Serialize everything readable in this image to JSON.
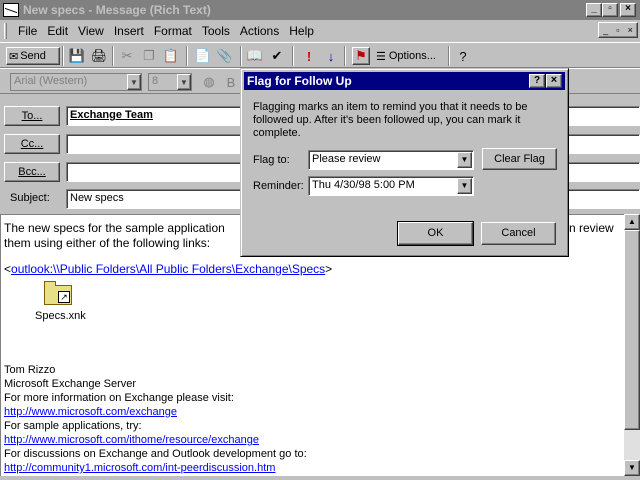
{
  "window": {
    "title": "New specs - Message (Rich Text)"
  },
  "menu": [
    "File",
    "Edit",
    "View",
    "Insert",
    "Format",
    "Tools",
    "Actions",
    "Help"
  ],
  "toolbar": {
    "send_label": "Send",
    "options_label": "Options..."
  },
  "format_toolbar": {
    "font": "Arial (Western)",
    "size": "8"
  },
  "addresses": {
    "to_button": "To...",
    "cc_button": "Cc...",
    "bcc_button": "Bcc...",
    "subject_label": "Subject:",
    "to_value": "Exchange Team",
    "cc_value": "",
    "bcc_value": "",
    "subject_value": "New specs"
  },
  "message": {
    "intro_start": "The new specs for the sample application",
    "intro_end": "n review",
    "intro_line2": "them using either of the following links:",
    "link_prefix": "<",
    "link_folder": "outlook:\\\\Public Folders\\All Public Folders\\Exchange\\Specs",
    "link_suffix": ">",
    "attachment_name": "Specs.xnk",
    "signature": {
      "name": "Tom Rizzo",
      "company": "Microsoft Exchange Server",
      "info1": "For more information on Exchange please visit:",
      "link1": "http://www.microsoft.com/exchange",
      "info2": "For sample applications, try:",
      "link2": "http://www.microsoft.com/ithome/resource/exchange",
      "info3": "For discussions on Exchange and Outlook development go to:",
      "link3": "http://community1.microsoft.com/int-peerdiscussion.htm"
    }
  },
  "dialog": {
    "title": "Flag for Follow Up",
    "description": "Flagging marks an item to remind you that it needs to be followed up. After it's been followed up, you can mark it complete.",
    "flag_to_label": "Flag to:",
    "flag_to_value": "Please review",
    "reminder_label": "Reminder:",
    "reminder_value": "Thu 4/30/98 5:00 PM",
    "clear_flag_button": "Clear Flag",
    "ok_button": "OK",
    "cancel_button": "Cancel"
  }
}
